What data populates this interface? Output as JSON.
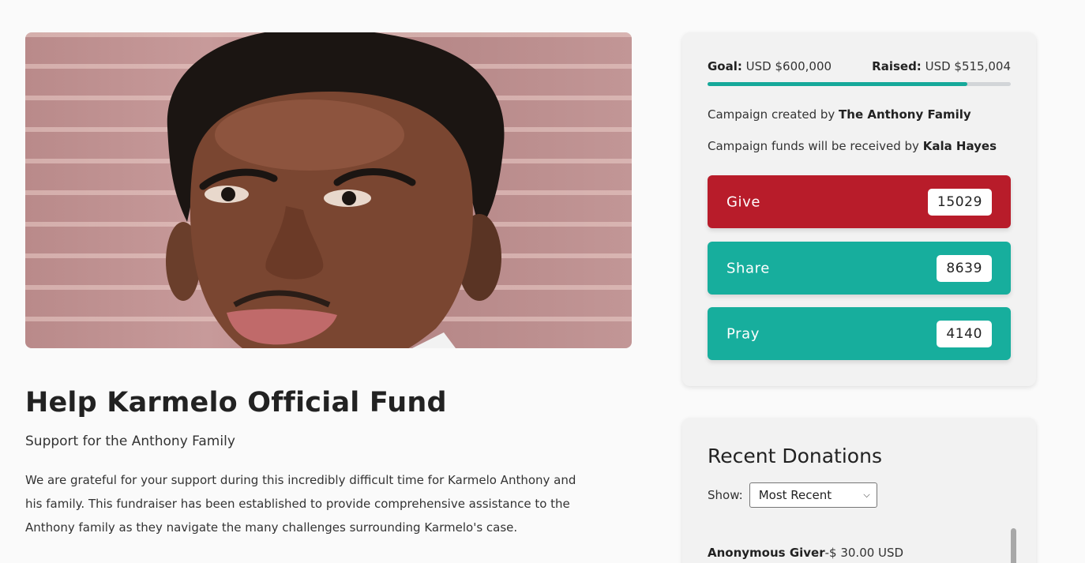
{
  "campaign": {
    "title": "Help Karmelo Official Fund",
    "subtitle": "Support for the Anthony Family",
    "description": "We are grateful for your support during this incredibly difficult time for Karmelo Anthony and his family. This fundraiser has been established to provide comprehensive assistance to the Anthony family as they navigate the many challenges surrounding Karmelo's case."
  },
  "funding": {
    "goal_label": "Goal:",
    "goal_value": "USD $600,000",
    "raised_label": "Raised:",
    "raised_value": "USD $515,004",
    "progress_fraction": 0.858
  },
  "creator": {
    "prefix": "Campaign created by",
    "name": "The Anthony Family"
  },
  "recipient": {
    "prefix": "Campaign funds will be received by",
    "name": "Kala Hayes"
  },
  "actions": {
    "give": {
      "label": "Give",
      "count": "15029"
    },
    "share": {
      "label": "Share",
      "count": "8639"
    },
    "pray": {
      "label": "Pray",
      "count": "4140"
    }
  },
  "donations": {
    "heading": "Recent Donations",
    "show_label": "Show:",
    "sort_selected": "Most Recent",
    "items": [
      {
        "name": "Anonymous Giver",
        "amount": "-$ 30.00 USD"
      }
    ]
  },
  "colors": {
    "give": "#b81c2a",
    "teal": "#17ae9d",
    "progress": "#16a99a"
  }
}
